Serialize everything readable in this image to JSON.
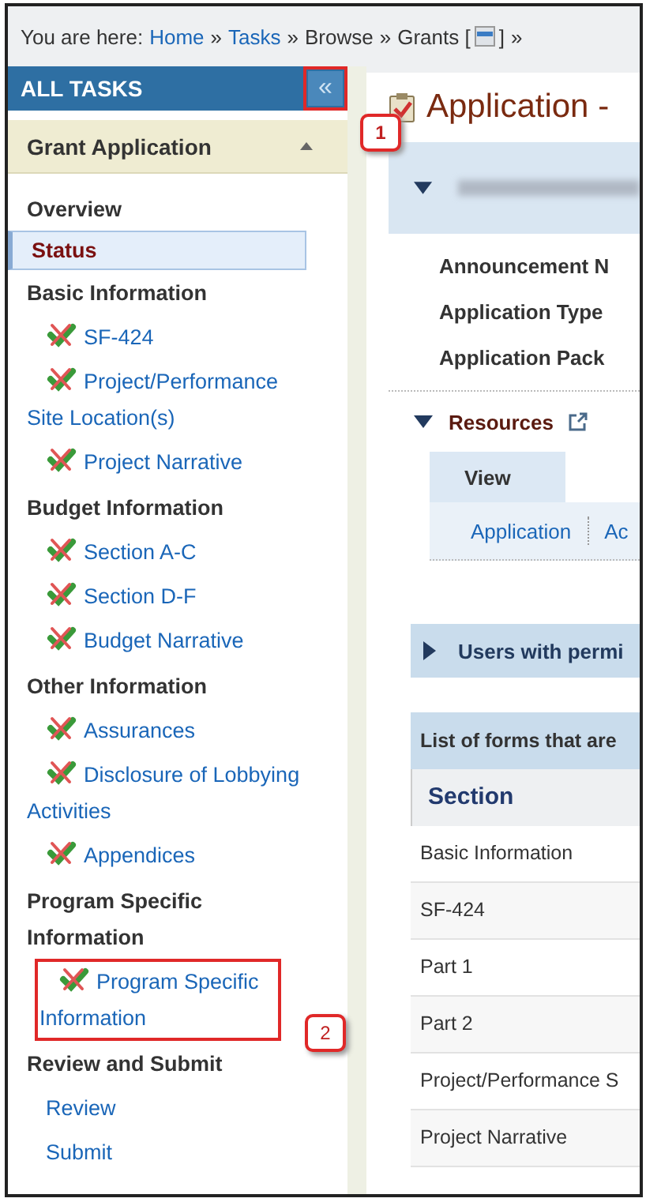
{
  "breadcrumb": {
    "label": "You are here:",
    "items": [
      {
        "text": "Home",
        "kind": "link"
      },
      {
        "text": "Tasks",
        "kind": "link"
      },
      {
        "text": "Browse",
        "kind": "text"
      },
      {
        "text": "Grants [",
        "kind": "text"
      },
      {
        "text": "]",
        "kind": "icon-suffix"
      }
    ],
    "separator": "»"
  },
  "sidebar": {
    "title": "ALL TASKS",
    "collapse_label": "«",
    "collapse_callout": "1",
    "section_title": "Grant Application",
    "expanded": true,
    "groups": [
      {
        "heading": "Overview",
        "items": [
          {
            "text": "Status",
            "kind": "link",
            "selected": true
          }
        ]
      },
      {
        "heading": "Basic Information",
        "items": [
          {
            "text": "SF-424",
            "kind": "form",
            "selected": false
          },
          {
            "text": "Project/Performance Site Location(s)",
            "kind": "form",
            "selected": false
          },
          {
            "text": "Project Narrative",
            "kind": "form",
            "selected": false
          }
        ]
      },
      {
        "heading": "Budget Information",
        "items": [
          {
            "text": "Section A-C",
            "kind": "form",
            "selected": false
          },
          {
            "text": "Section D-F",
            "kind": "form",
            "selected": false
          },
          {
            "text": "Budget Narrative",
            "kind": "form",
            "selected": false
          }
        ]
      },
      {
        "heading": "Other Information",
        "items": [
          {
            "text": "Assurances",
            "kind": "form",
            "selected": false
          },
          {
            "text": "Disclosure of Lobbying Activities",
            "kind": "form",
            "selected": false
          },
          {
            "text": "Appendices",
            "kind": "form",
            "selected": false
          }
        ]
      },
      {
        "heading": "Program Specific Information",
        "items": [
          {
            "text": "Program Specific Information",
            "kind": "form",
            "selected": false,
            "callout": "2"
          }
        ]
      },
      {
        "heading": "Review and Submit",
        "items": [
          {
            "text": "Review",
            "kind": "link",
            "selected": false
          },
          {
            "text": "Submit",
            "kind": "link",
            "selected": false
          }
        ]
      }
    ]
  },
  "main": {
    "title": "Application -",
    "summary": {
      "expanded": true,
      "fields": [
        "Announcement N",
        "Application Type",
        "Application Pack"
      ]
    },
    "resources": {
      "title": "Resources",
      "expanded": true,
      "tabs": [
        {
          "label": "View",
          "selected": true
        }
      ],
      "links": [
        "Application",
        "Ac"
      ]
    },
    "users_panel": {
      "title": "Users with permi",
      "expanded": false
    },
    "forms_table": {
      "caption": "List of forms that are",
      "columns": [
        "Section"
      ],
      "rows": [
        [
          "Basic Information"
        ],
        [
          "SF-424"
        ],
        [
          "Part 1"
        ],
        [
          "Part 2"
        ],
        [
          "Project/Performance S"
        ],
        [
          "Project Narrative"
        ]
      ]
    }
  }
}
